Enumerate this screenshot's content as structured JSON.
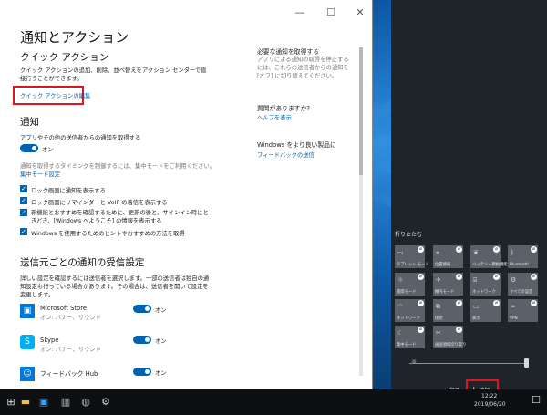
{
  "window": {
    "controls": [
      "—",
      "☐",
      "✕"
    ],
    "title": "通知とアクション",
    "quick_action": {
      "heading": "クイック アクション",
      "description": "クイック アクションの追加、削除、並べ替えをアクション センターで直接行うことができます。",
      "edit_link": "クイック アクションの編集"
    },
    "notifications": {
      "heading": "通知",
      "get_from_apps_label": "アプリやその他の送信者からの通知を取得する",
      "toggle_state": "オン",
      "focus_desc": "通知を取得するタイミングを制御するには、集中モードをご利用ください。",
      "focus_link": "集中モード設定",
      "checkboxes": [
        "ロック画面に通知を表示する",
        "ロック画面にリマインダーと VoIP の着信を表示する",
        "新機能とおすすめを確認するために、更新の後と、サインイン時にときどき、[Windows へようこそ] の情報を表示する",
        "Windows を使用するためのヒントやおすすめの方法を取得"
      ]
    },
    "per_sender": {
      "heading": "送信元ごとの通知の受信設定",
      "description": "詳しい設定を確認するには送信者を選択します。一部の送信者は独自の通知設定も行っている場合があります。その場合は、送信者を開いて設定を変更します。",
      "apps": [
        {
          "name": "Microsoft Store",
          "sub": "オン: バナー、サウンド",
          "toggle": "オン"
        },
        {
          "name": "Skype",
          "sub": "オン: バナー、サウンド",
          "toggle": "オン"
        },
        {
          "name": "フィードバック Hub",
          "sub": "",
          "toggle": "オン"
        }
      ]
    },
    "side": {
      "important_heading": "必要な通知を取得する",
      "important_desc": "アプリによる通知の取得を停止するには、これらの送信者からの通知を [オフ] に切り替えてください。",
      "question_heading": "質問がありますか?",
      "help_link": "ヘルプを表示",
      "improve_heading": "Windows をより良い製品に",
      "feedback_link": "フィードバックの送信"
    }
  },
  "action_center": {
    "collapse_label": "折りたたむ",
    "tiles": [
      "タブレット モード",
      "位置情報",
      "バッテリー節約機能",
      "Bluetooth",
      "夜間モード",
      "機内モード",
      "ネットワーク",
      "すべての設定",
      "ネットワーク",
      "接続",
      "表示",
      "VPN",
      "集中モード",
      "画面領域切り取り"
    ],
    "done_label": "完了",
    "add_label": "追加"
  },
  "taskbar": {
    "time": "12:22",
    "date": "2019/06/20"
  },
  "colors": {
    "accent": "#0063b1",
    "highlight": "#e0141e",
    "action_center_bg": "#1f2428",
    "tile_bg": "#5a6169"
  }
}
